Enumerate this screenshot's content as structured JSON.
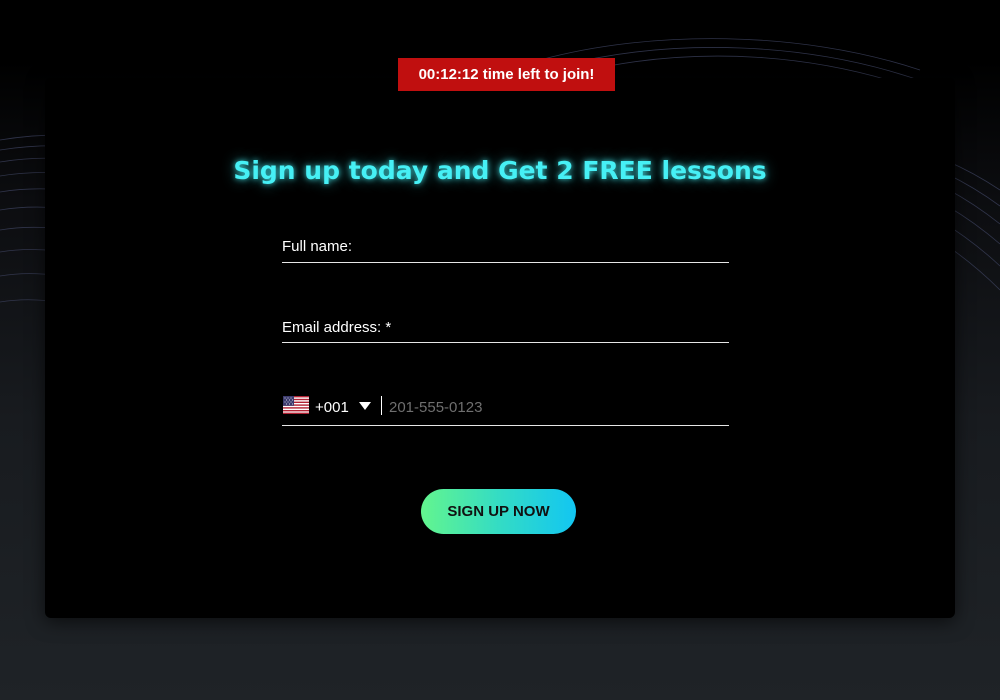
{
  "timer": {
    "text": "00:12:12 time left to join!",
    "color": "#c00f0f"
  },
  "headline": {
    "text": "Sign up today and Get 2 FREE lessons",
    "color": "#46f0f5"
  },
  "form": {
    "full_name": {
      "label": "Full name:",
      "value": ""
    },
    "email": {
      "label": "Email address: *",
      "value": ""
    },
    "phone": {
      "country_flag": "us-flag-icon",
      "dial_code": "+001",
      "value": "",
      "placeholder": "201-555-0123"
    },
    "submit_label": "SIGN UP NOW"
  },
  "colors": {
    "button_gradient_start": "#63f58e",
    "button_gradient_end": "#12c6f2",
    "card_background": "#000000"
  }
}
